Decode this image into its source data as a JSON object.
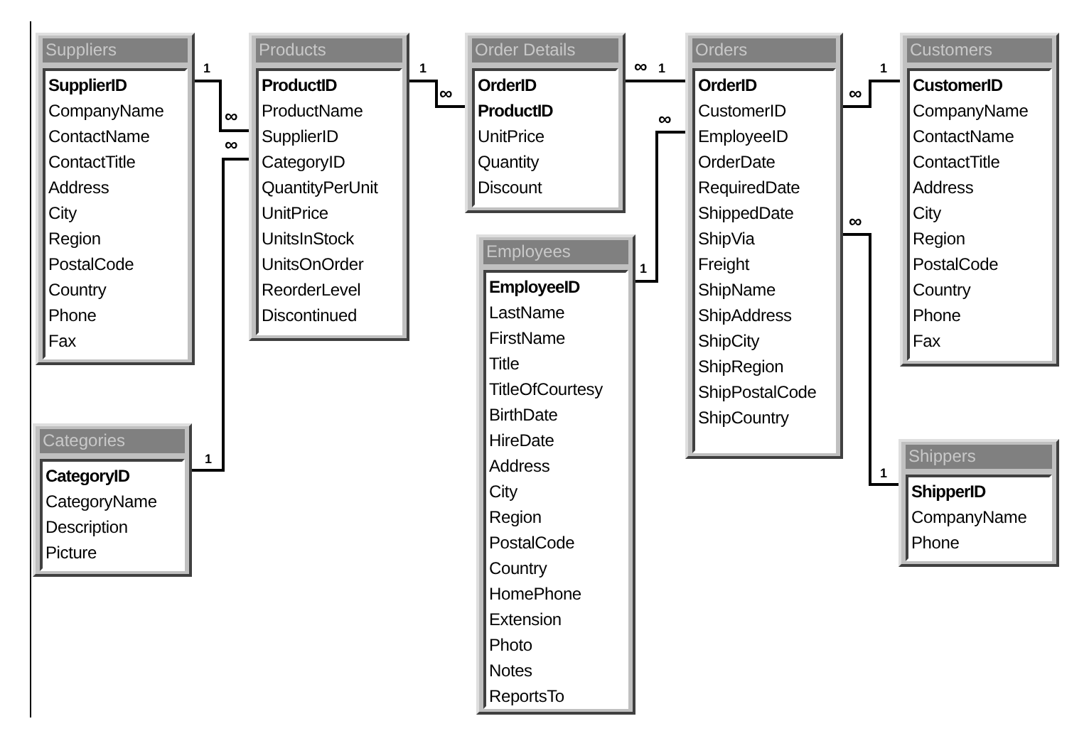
{
  "tables": [
    {
      "title": "Suppliers",
      "fields": [
        {
          "name": "SupplierID",
          "primary_key": true
        },
        {
          "name": "CompanyName",
          "primary_key": false
        },
        {
          "name": "ContactName",
          "primary_key": false
        },
        {
          "name": "ContactTitle",
          "primary_key": false
        },
        {
          "name": "Address",
          "primary_key": false
        },
        {
          "name": "City",
          "primary_key": false
        },
        {
          "name": "Region",
          "primary_key": false
        },
        {
          "name": "PostalCode",
          "primary_key": false
        },
        {
          "name": "Country",
          "primary_key": false
        },
        {
          "name": "Phone",
          "primary_key": false
        },
        {
          "name": "Fax",
          "primary_key": false
        }
      ]
    },
    {
      "title": "Products",
      "fields": [
        {
          "name": "ProductID",
          "primary_key": true
        },
        {
          "name": "ProductName",
          "primary_key": false
        },
        {
          "name": "SupplierID",
          "primary_key": false
        },
        {
          "name": "CategoryID",
          "primary_key": false
        },
        {
          "name": "QuantityPerUnit",
          "primary_key": false
        },
        {
          "name": "UnitPrice",
          "primary_key": false
        },
        {
          "name": "UnitsInStock",
          "primary_key": false
        },
        {
          "name": "UnitsOnOrder",
          "primary_key": false
        },
        {
          "name": "ReorderLevel",
          "primary_key": false
        },
        {
          "name": "Discontinued",
          "primary_key": false
        }
      ]
    },
    {
      "title": "Order Details",
      "fields": [
        {
          "name": "OrderID",
          "primary_key": true
        },
        {
          "name": "ProductID",
          "primary_key": true
        },
        {
          "name": "UnitPrice",
          "primary_key": false
        },
        {
          "name": "Quantity",
          "primary_key": false
        },
        {
          "name": "Discount",
          "primary_key": false
        }
      ]
    },
    {
      "title": "Orders",
      "fields": [
        {
          "name": "OrderID",
          "primary_key": true
        },
        {
          "name": "CustomerID",
          "primary_key": false
        },
        {
          "name": "EmployeeID",
          "primary_key": false
        },
        {
          "name": "OrderDate",
          "primary_key": false
        },
        {
          "name": "RequiredDate",
          "primary_key": false
        },
        {
          "name": "ShippedDate",
          "primary_key": false
        },
        {
          "name": "ShipVia",
          "primary_key": false
        },
        {
          "name": "Freight",
          "primary_key": false
        },
        {
          "name": "ShipName",
          "primary_key": false
        },
        {
          "name": "ShipAddress",
          "primary_key": false
        },
        {
          "name": "ShipCity",
          "primary_key": false
        },
        {
          "name": "ShipRegion",
          "primary_key": false
        },
        {
          "name": "ShipPostalCode",
          "primary_key": false
        },
        {
          "name": "ShipCountry",
          "primary_key": false
        }
      ]
    },
    {
      "title": "Customers",
      "fields": [
        {
          "name": "CustomerID",
          "primary_key": true
        },
        {
          "name": "CompanyName",
          "primary_key": false
        },
        {
          "name": "ContactName",
          "primary_key": false
        },
        {
          "name": "ContactTitle",
          "primary_key": false
        },
        {
          "name": "Address",
          "primary_key": false
        },
        {
          "name": "City",
          "primary_key": false
        },
        {
          "name": "Region",
          "primary_key": false
        },
        {
          "name": "PostalCode",
          "primary_key": false
        },
        {
          "name": "Country",
          "primary_key": false
        },
        {
          "name": "Phone",
          "primary_key": false
        },
        {
          "name": "Fax",
          "primary_key": false
        }
      ]
    },
    {
      "title": "Employees",
      "fields": [
        {
          "name": "EmployeeID",
          "primary_key": true
        },
        {
          "name": "LastName",
          "primary_key": false
        },
        {
          "name": "FirstName",
          "primary_key": false
        },
        {
          "name": "Title",
          "primary_key": false
        },
        {
          "name": "TitleOfCourtesy",
          "primary_key": false
        },
        {
          "name": "BirthDate",
          "primary_key": false
        },
        {
          "name": "HireDate",
          "primary_key": false
        },
        {
          "name": "Address",
          "primary_key": false
        },
        {
          "name": "City",
          "primary_key": false
        },
        {
          "name": "Region",
          "primary_key": false
        },
        {
          "name": "PostalCode",
          "primary_key": false
        },
        {
          "name": "Country",
          "primary_key": false
        },
        {
          "name": "HomePhone",
          "primary_key": false
        },
        {
          "name": "Extension",
          "primary_key": false
        },
        {
          "name": "Photo",
          "primary_key": false
        },
        {
          "name": "Notes",
          "primary_key": false
        },
        {
          "name": "ReportsTo",
          "primary_key": false
        }
      ]
    },
    {
      "title": "Categories",
      "fields": [
        {
          "name": "CategoryID",
          "primary_key": true
        },
        {
          "name": "CategoryName",
          "primary_key": false
        },
        {
          "name": "Description",
          "primary_key": false
        },
        {
          "name": "Picture",
          "primary_key": false
        }
      ]
    },
    {
      "title": "Shippers",
      "fields": [
        {
          "name": "ShipperID",
          "primary_key": true
        },
        {
          "name": "CompanyName",
          "primary_key": false
        },
        {
          "name": "Phone",
          "primary_key": false
        }
      ]
    }
  ],
  "relationships": [
    {
      "one_label": "1",
      "many_label": "∞"
    },
    {
      "one_label": "1",
      "many_label": "∞"
    },
    {
      "one_label": "1",
      "many_label": "∞"
    },
    {
      "one_label": "1",
      "many_label": "∞"
    },
    {
      "one_label": "1",
      "many_label": "∞"
    },
    {
      "one_label": "1",
      "many_label": "∞"
    },
    {
      "one_label": "1",
      "many_label": "∞"
    }
  ]
}
